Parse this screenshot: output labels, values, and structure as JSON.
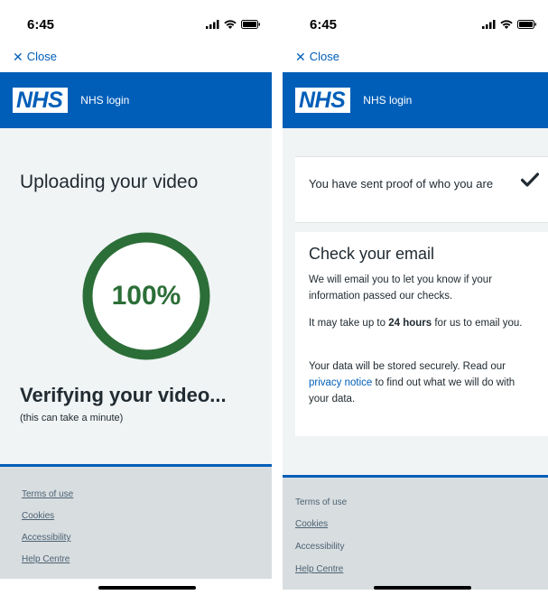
{
  "left": {
    "status_time": "6:45",
    "close_label": "Close",
    "nhs_logo": "NHS",
    "service_name": "NHS login",
    "title": "Uploading your video",
    "progress_label": "100%",
    "progress_fraction": 1.0,
    "verify_title": "Verifying your video...",
    "verify_sub": "(this can take a minute)",
    "footer_links": [
      "Terms of use",
      "Cookies",
      "Accessibility",
      "Help Centre"
    ]
  },
  "right": {
    "status_time": "6:45",
    "close_label": "Close",
    "nhs_logo": "NHS",
    "service_name": "NHS login",
    "confirmation": "You have sent proof of who you are",
    "email_title": "Check your email",
    "email_p1": "We will email you to let you know if your information passed our checks.",
    "email_p2_pre": "It may take up to ",
    "email_p2_bold": "24 hours",
    "email_p2_post": " for us to email you.",
    "email_p3_pre": "Your data will be stored securely. Read our ",
    "email_p3_link": "privacy notice",
    "email_p3_post": " to find out what we will do with your data.",
    "footer_links": [
      "Terms of use",
      "Cookies",
      "Accessibility",
      "Help Centre"
    ]
  },
  "icons": {
    "close": "close-icon",
    "check": "checkmark-icon",
    "signal": "signal-icon",
    "wifi": "wifi-icon",
    "battery": "battery-icon"
  },
  "colors": {
    "nhs_blue": "#005eb8",
    "progress_green": "#2c6e38",
    "page_background": "#f0f4f5",
    "footer_background": "#d8dde0"
  }
}
